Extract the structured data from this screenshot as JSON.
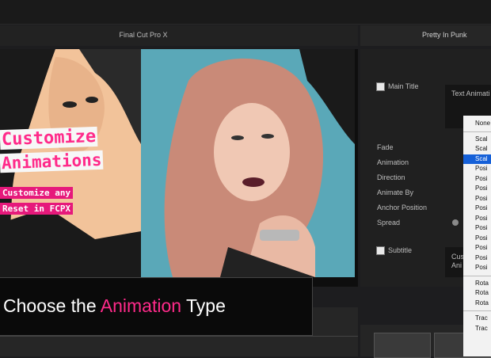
{
  "app": {
    "window_title": "Final Cut Pro X"
  },
  "viewer": {
    "overlay_title_line1": "Customize",
    "overlay_title_line2": "Animations",
    "overlay_sub_line1": "Customize any",
    "overlay_sub_line2": "Reset in FCPX"
  },
  "caption": {
    "prefix": "Choose the ",
    "highlight": "Animation",
    "suffix": " Type"
  },
  "inspector": {
    "title": "Pretty In Punk",
    "main_title_label": "Main Title",
    "text_animation_label": "Text Animati",
    "params": [
      "Fade",
      "Animation",
      "Direction",
      "Animate By",
      "Anchor Position",
      "Spread"
    ],
    "subtitle_label": "Subtitle",
    "subtitle_text": "Cus\nAni"
  },
  "dropdown": {
    "group1": [
      "None"
    ],
    "group2": [
      "Scal",
      "Scal",
      "Scal",
      "Posi",
      "Posi",
      "Posi",
      "Posi",
      "Posi",
      "Posi",
      "Posi",
      "Posi",
      "Posi",
      "Posi",
      "Posi"
    ],
    "selected_index": 2,
    "group3": [
      "Rota",
      "Rota",
      "Rota"
    ],
    "group4": [
      "Trac",
      "Trac"
    ]
  },
  "colors": {
    "accent": "#ff2a8a",
    "selection": "#1560d8"
  }
}
